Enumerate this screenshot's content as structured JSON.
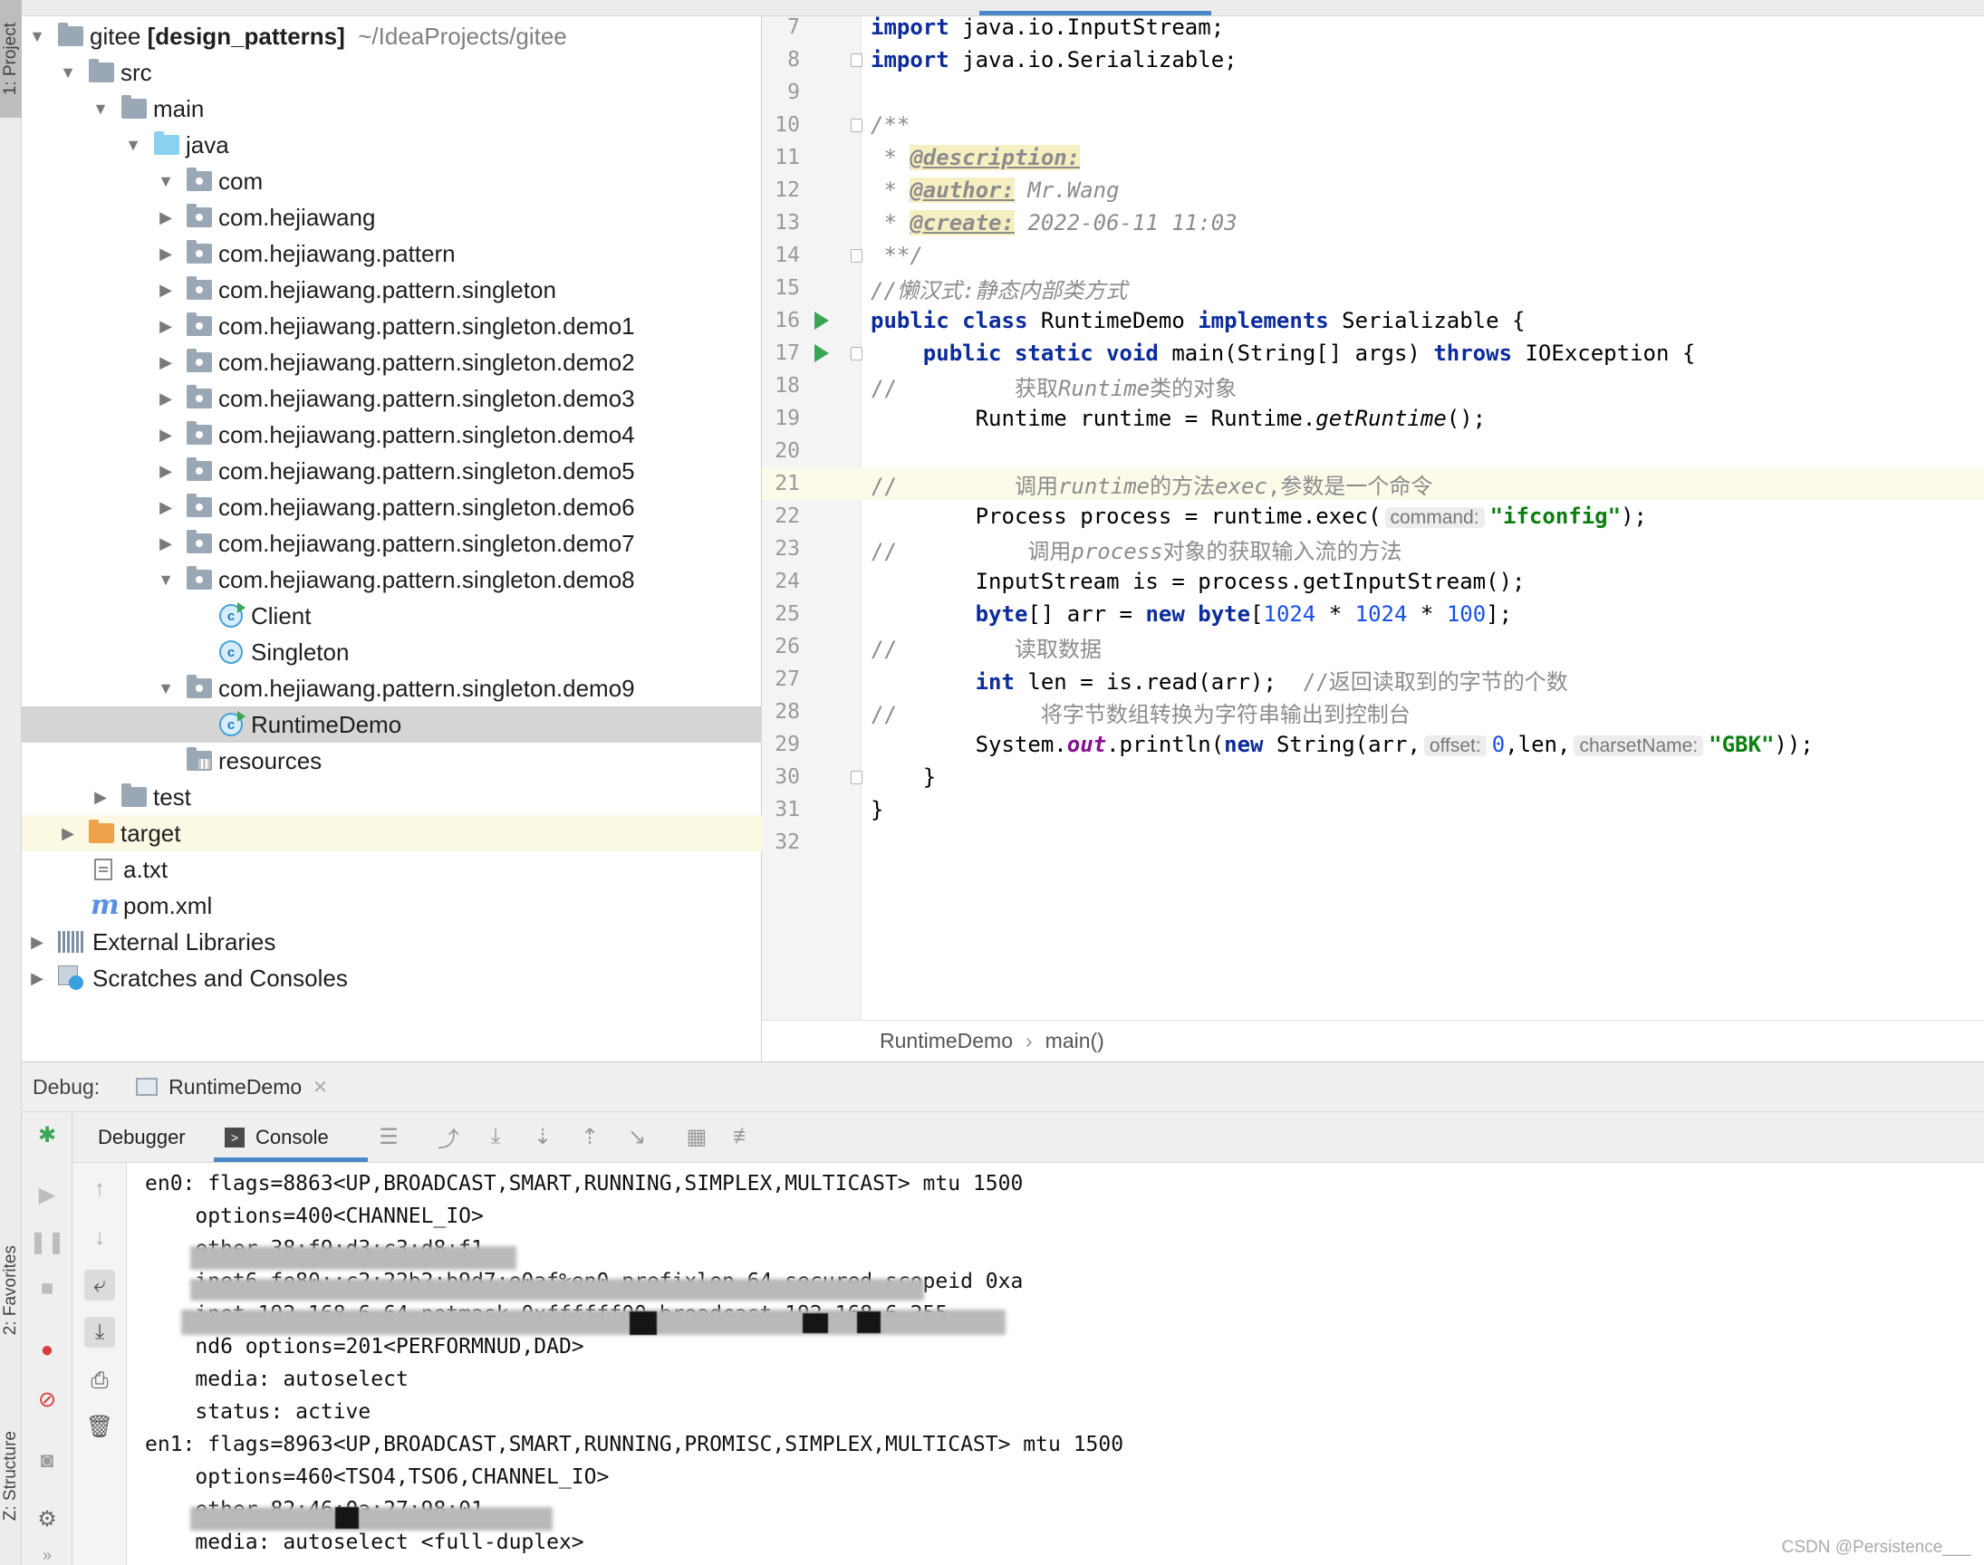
{
  "tool_strip": {
    "project_tab": "1: Project",
    "favorites_tab": "2: Favorites",
    "structure_tab": "Z: Structure"
  },
  "project_tree": {
    "root_name": "gitee",
    "root_module": "[design_patterns]",
    "root_path": "~/IdeaProjects/gitee",
    "items": [
      {
        "label": "src"
      },
      {
        "label": "main"
      },
      {
        "label": "java"
      },
      {
        "label": "com"
      },
      {
        "label": "com.hejiawang"
      },
      {
        "label": "com.hejiawang.pattern"
      },
      {
        "label": "com.hejiawang.pattern.singleton"
      },
      {
        "label": "com.hejiawang.pattern.singleton.demo1"
      },
      {
        "label": "com.hejiawang.pattern.singleton.demo2"
      },
      {
        "label": "com.hejiawang.pattern.singleton.demo3"
      },
      {
        "label": "com.hejiawang.pattern.singleton.demo4"
      },
      {
        "label": "com.hejiawang.pattern.singleton.demo5"
      },
      {
        "label": "com.hejiawang.pattern.singleton.demo6"
      },
      {
        "label": "com.hejiawang.pattern.singleton.demo7"
      },
      {
        "label": "com.hejiawang.pattern.singleton.demo8"
      },
      {
        "label": "Client"
      },
      {
        "label": "Singleton"
      },
      {
        "label": "com.hejiawang.pattern.singleton.demo9"
      },
      {
        "label": "RuntimeDemo"
      },
      {
        "label": "resources"
      },
      {
        "label": "test"
      },
      {
        "label": "target"
      },
      {
        "label": "a.txt"
      },
      {
        "label": "pom.xml"
      },
      {
        "label": "External Libraries"
      },
      {
        "label": "Scratches and Consoles"
      }
    ]
  },
  "editor": {
    "line_numbers": [
      "7",
      "8",
      "9",
      "10",
      "11",
      "12",
      "13",
      "14",
      "15",
      "16",
      "17",
      "18",
      "19",
      "20",
      "21",
      "22",
      "23",
      "24",
      "25",
      "26",
      "27",
      "28",
      "29",
      "30",
      "31",
      "32"
    ],
    "code": {
      "l7_kw": "import",
      "l7_rest": " java.io.InputStream;",
      "l8_kw": "import",
      "l8_rest": " java.io.Serializable;",
      "l10": "/**",
      "l11_star": " * ",
      "l11_tag": "@description:",
      "l12_star": " * ",
      "l12_tag": "@author:",
      "l12_val": " Mr.Wang",
      "l13_star": " * ",
      "l13_tag": "@create:",
      "l13_val": " 2022-06-11 11:03",
      "l14": " **/",
      "l15": "//懒汉式:静态内部类方式",
      "l16_kw1": "public class",
      "l16_mid": " RuntimeDemo ",
      "l16_kw2": "implements",
      "l16_end": " Serializable {",
      "l17_indent": "    ",
      "l17_kw1": "public static void",
      "l17_mid": " main(String[] args) ",
      "l17_kw2": "throws",
      "l17_end": " IOException {",
      "l18_cm": "//",
      "l18_txt": "         获取",
      "l18_it": "Runtime",
      "l18_txt2": "类的对象",
      "l19": "        Runtime runtime = Runtime.",
      "l19_m": "getRuntime",
      "l19_end": "();",
      "l21_cm": "//",
      "l21_txt": "         调用",
      "l21_it": "runtime",
      "l21_txt2": "的方法",
      "l21_it2": "exec",
      "l21_txt3": ",参数是一个命令",
      "l22": "        Process process = runtime.exec(",
      "l22_hint": "command:",
      "l22_str": "\"ifconfig\"",
      "l22_end": ");",
      "l23_cm": "//",
      "l23_txt": "          调用",
      "l23_it": "process",
      "l23_txt2": "对象的获取输入流的方法",
      "l24": "        InputStream is = process.getInputStream();",
      "l25_indent": "        ",
      "l25_kw": "byte",
      "l25_a": "[] arr = ",
      "l25_kw2": "new",
      "l25_sp": " ",
      "l25_kw3": "byte",
      "l25_b": "[",
      "l25_n1": "1024",
      "l25_c": " * ",
      "l25_n2": "1024",
      "l25_d": " * ",
      "l25_n3": "100",
      "l25_e": "];",
      "l26_cm": "//",
      "l26_txt": "         读取数据",
      "l27_indent": "        ",
      "l27_kw": "int",
      "l27_mid": " len = is.read(arr);  ",
      "l27_cm": "//返回读取到的字节的个数",
      "l28_cm": "//",
      "l28_txt": "           将字节数组转换为字符串输出到控制台",
      "l29_a": "        System.",
      "l29_out": "out",
      "l29_b": ".println(",
      "l29_kw": "new",
      "l29_c": " String(arr,",
      "l29_hint1": "offset:",
      "l29_n": "0",
      "l29_d": ",len,",
      "l29_hint2": "charsetName:",
      "l29_str": "\"GBK\"",
      "l29_e": "));",
      "l30": "    }",
      "l31": "}"
    },
    "breadcrumb": [
      "RuntimeDemo",
      "main()"
    ]
  },
  "debug": {
    "label": "Debug:",
    "session_tab": "RuntimeDemo",
    "tabs": [
      "Debugger",
      "Console"
    ],
    "console_lines": [
      "en0: flags=8863<UP,BROADCAST,SMART,RUNNING,SIMPLEX,MULTICAST> mtu 1500",
      "    options=400<CHANNEL_IO>",
      "    ether 38:f9:d3:c3:d8:f1",
      "    inet6 fe80::c2:22b2:b9d7:e0af%en0 prefixlen 64 secured scopeid 0xa",
      "    inet 192.168.6.64 netmask 0xffffff00 broadcast 192.168.6.255",
      "    nd6 options=201<PERFORMNUD,DAD>",
      "    media: autoselect",
      "    status: active",
      "en1: flags=8963<UP,BROADCAST,SMART,RUNNING,PROMISC,SIMPLEX,MULTICAST> mtu 1500",
      "    options=460<TSO4,TSO6,CHANNEL_IO>",
      "    ether 82:46:0a:27:98:01",
      "    media: autoselect <full-duplex>"
    ]
  },
  "watermark": "CSDN @Persistence___",
  "colors": {
    "keyword": "#0b2b9c",
    "string": "#0a7f11",
    "number": "#1750eb",
    "comment": "#8c8c8c",
    "selection": "#d5d5d5",
    "current_line": "#fcfae9",
    "run_marker": "#3aa655",
    "accent": "#4a88c7"
  }
}
